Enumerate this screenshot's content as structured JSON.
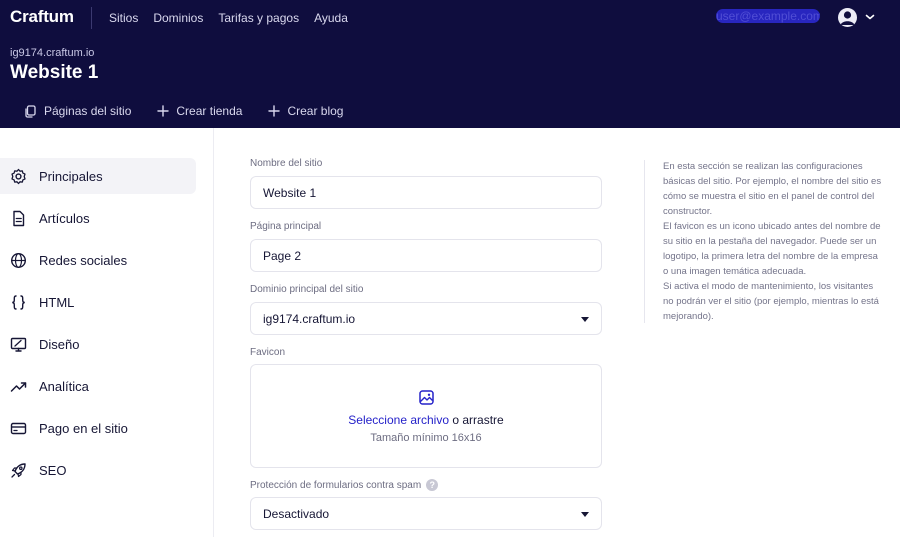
{
  "topbar": {
    "logo": "Craftum",
    "nav": [
      "Sitios",
      "Dominios",
      "Tarifas y pagos",
      "Ayuda"
    ],
    "user_name": "user@example.com"
  },
  "site": {
    "url": "ig9174.craftum.io",
    "title": "Website 1"
  },
  "subnav": {
    "pages": "Páginas del sitio",
    "shop": "Crear tienda",
    "blog": "Crear blog"
  },
  "sidebar": {
    "items": [
      {
        "label": "Principales",
        "icon": "gear-icon"
      },
      {
        "label": "Artículos",
        "icon": "document-icon"
      },
      {
        "label": "Redes sociales",
        "icon": "globe-icon"
      },
      {
        "label": "HTML",
        "icon": "code-braces-icon"
      },
      {
        "label": "Diseño",
        "icon": "monitor-design-icon"
      },
      {
        "label": "Analítica",
        "icon": "trend-icon"
      },
      {
        "label": "Pago en el sitio",
        "icon": "card-icon"
      },
      {
        "label": "SEO",
        "icon": "rocket-icon"
      }
    ],
    "active_index": 0
  },
  "form": {
    "site_name_label": "Nombre del sitio",
    "site_name_value": "Website 1",
    "home_page_label": "Página principal",
    "home_page_value": "Page 2",
    "domain_label": "Dominio principal del sitio",
    "domain_value": "ig9174.craftum.io",
    "favicon_label": "Favicon",
    "favicon_select": "Seleccione archivo",
    "favicon_or": "o arrastre",
    "favicon_hint": "Tamaño mínimo 16x16",
    "spam_label": "Protección de formularios contra spam",
    "spam_help": "?",
    "spam_value": "Desactivado"
  },
  "help": {
    "p1": "En esta sección se realizan las configuraciones básicas del sitio. Por ejemplo, el nombre del sitio es cómo se muestra el sitio en el panel de control del constructor.",
    "p2": "El favicon es un icono ubicado antes del nombre de su sitio en la pestaña del navegador. Puede ser un logotipo, la primera letra del nombre de la empresa o una imagen temática adecuada.",
    "p3": "Si activa el modo de mantenimiento, los visitantes no podrán ver el sitio (por ejemplo, mientras lo está mejorando)."
  },
  "colors": {
    "header_bg": "#0f0d3e",
    "accent": "#2522c9",
    "active_bg": "#f3f3f7"
  }
}
